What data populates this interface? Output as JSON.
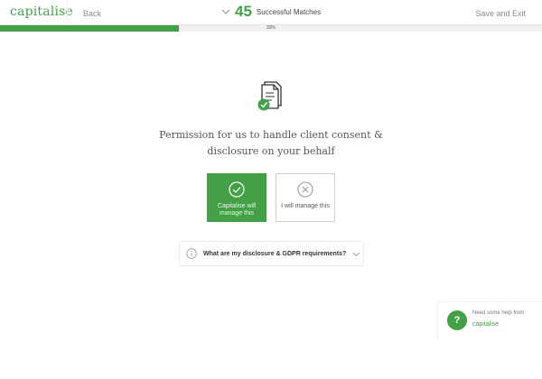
{
  "header": {
    "logo": "capitalise",
    "back_label": "Back",
    "match_count": "45",
    "match_label": "Successful Matches",
    "save_exit_label": "Save and Exit"
  },
  "progress": {
    "percent": 33,
    "label": "33%"
  },
  "main": {
    "question": "Permission for us to handle client consent & disclosure on your behalf",
    "options": [
      {
        "label": "Capitalise will manage this",
        "selected": true,
        "icon": "check-circle-icon"
      },
      {
        "label": "I will manage this",
        "selected": false,
        "icon": "x-circle-icon"
      }
    ],
    "faq_label": "What are my disclosure & GDPR requirements?"
  },
  "help": {
    "text": "Need some help from",
    "brand": "capitalise",
    "icon_glyph": "?"
  },
  "colors": {
    "accent": "#43a047",
    "border": "#cfcfcf",
    "muted_text": "#8a8a8a"
  }
}
